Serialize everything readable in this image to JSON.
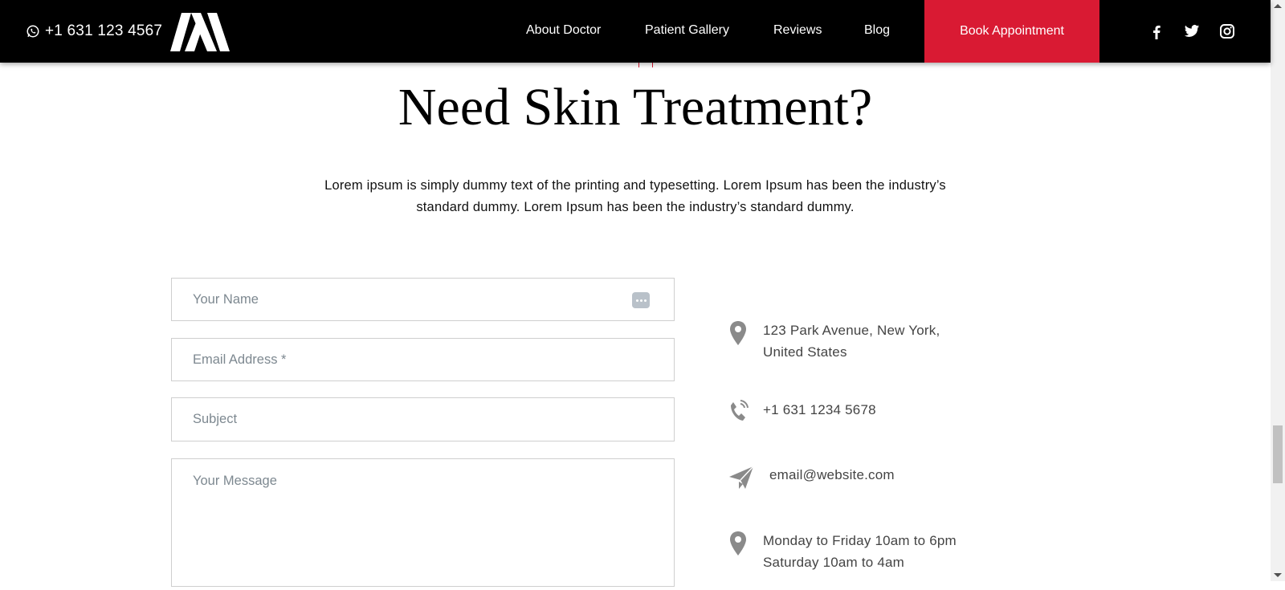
{
  "header": {
    "phone": "+1 631 123 4567",
    "nav": [
      "About Doctor",
      "Patient Gallery",
      "Reviews",
      "Blog"
    ],
    "book_label": "Book Appointment",
    "social_icons": [
      "facebook-icon",
      "twitter-icon",
      "instagram-icon"
    ]
  },
  "main": {
    "title": "Need Skin Treatment?",
    "intro_line1": "Lorem ipsum is simply dummy text of the printing and typesetting. Lorem Ipsum has been the industry’s",
    "intro_line2": "standard dummy. Lorem Ipsum has been the industry’s standard dummy."
  },
  "form": {
    "name_placeholder": "Your Name",
    "email_placeholder": "Email Address *",
    "subject_placeholder": "Subject",
    "message_placeholder": "Your Message"
  },
  "contact": {
    "address_line1": "123 Park Avenue, New York,",
    "address_line2": "United States",
    "phone": "+1 631 1234 5678",
    "email": "email@website.com",
    "hours_line1": "Monday to Friday 10am to 6pm",
    "hours_line2": "Saturday 10am to 4am"
  },
  "colors": {
    "header_bg": "#000000",
    "accent": "#d91a33",
    "icon_gray": "#8a8a8a"
  }
}
